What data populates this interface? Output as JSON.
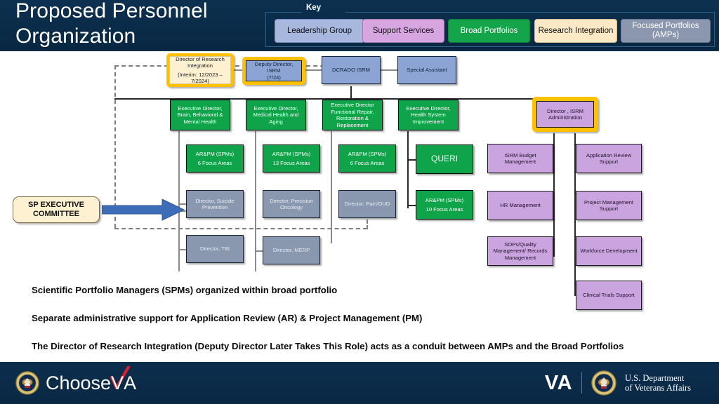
{
  "header": {
    "title": "Proposed Personnel Organization",
    "key_label": "Key",
    "key_items": [
      {
        "label": "Leadership Group",
        "color": "#a7b7dd"
      },
      {
        "label": "Support Services",
        "color": "#d7a6e0"
      },
      {
        "label": "Broad Portfolios",
        "color": "#14a44a"
      },
      {
        "label": "Research Integration",
        "color": "#fbe8c4"
      },
      {
        "label": "Focused Portfolios (AMPs)",
        "color": "#8b96af"
      }
    ]
  },
  "chart_data": {
    "type": "diagram",
    "title": "Proposed Personnel Organization",
    "nodes": {
      "dri": "Director of Research Integration (Interim: 12/2023 – 7/2024)",
      "dri_line1": "Director of Research Integration",
      "dri_line2": "(Interim: 12/2023 – 7/2024)",
      "deputy": "Deputy Director, ISRM (7/24)",
      "deputy_line1": "Deputy Director, ISRM",
      "deputy_line2": "(7/24)",
      "dcrado": "DCRADO ISRM",
      "special_assistant": "Special Assistant",
      "ed_brain": "Executive Director, Brain, Behavioral & Mental Health",
      "ed_medical": "Executive Director, Medical Health and Aging",
      "ed_functional": "Executive Director Functional Repair, Restoration & Replacement",
      "ed_health_system": "Executive Director, Health System Improvement",
      "dir_isrm_admin": "Director , ISRM Administration",
      "arpm_6a_l1": "AR&PM (SPMs)",
      "arpm_6a_l2": "6 Focus Areas",
      "arpm_13_l1": "AR&PM (SPMs)",
      "arpm_13_l2": "13 Focus Areas",
      "arpm_6b_l1": "AR&PM (SPMs)",
      "arpm_6b_l2": "6 Focus Areas",
      "queri": "QUERI",
      "arpm_10_l1": "AR&PM (SPMs)",
      "arpm_10_l2": "10 Focus Areas",
      "dir_suicide": "Director, Suicide Prevention",
      "dir_oncology": "Director, Precision Oncology",
      "dir_pain": "Director, Pain/OUD",
      "dir_tbi": "Director, TBI",
      "dir_merp": "Director, MERP",
      "isrm_budget": "ISRM Budget Management",
      "hr_management": "HR Management",
      "sops_quality": "SOPs/Quality Management/ Records Management",
      "app_review": "Application Review Support",
      "proj_mgmt": "Project Management Support",
      "workforce": "Workforce Development",
      "clinical_trials": "Clinical Trials Support",
      "sp_committee_l1": "SP EXECUTIVE",
      "sp_committee_l2": "COMMITTEE"
    }
  },
  "bullets": [
    "Scientific Portfolio Managers (SPMs) organized within broad portfolio",
    "Separate administrative support for Application Review (AR) & Project Management (PM)",
    "The Director of Research Integration (Deputy Director Later Takes This Role) acts as a conduit between AMPs and the Broad Portfolios"
  ],
  "footer": {
    "choose_text": "Choose",
    "choose_v": "V",
    "choose_a": "A",
    "va_abbr": "VA",
    "dept_line1": "U.S. Department",
    "dept_line2": "of Veterans Affairs"
  }
}
